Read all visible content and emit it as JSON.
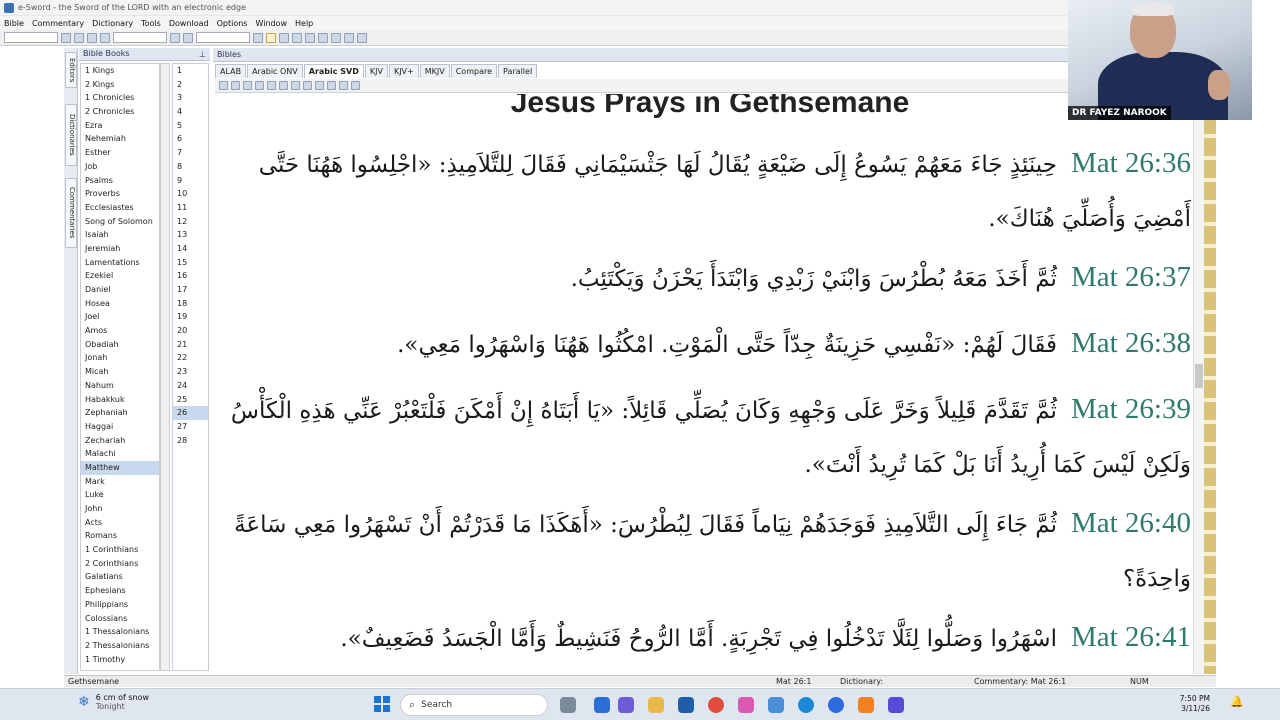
{
  "window": {
    "title": "e-Sword - the Sword of the LORD with an electronic edge"
  },
  "menu": [
    "Bible",
    "Commentary",
    "Dictionary",
    "Tools",
    "Download",
    "Options",
    "Window",
    "Help"
  ],
  "left_tabs": [
    "Editors",
    "Dictionaries",
    "Commentaries"
  ],
  "bible_books_header": "Bible Books",
  "books": [
    "1 Kings",
    "2 Kings",
    "1 Chronicles",
    "2 Chronicles",
    "Ezra",
    "Nehemiah",
    "Esther",
    "Job",
    "Psalms",
    "Proverbs",
    "Ecclesiastes",
    "Song of Solomon",
    "Isaiah",
    "Jeremiah",
    "Lamentations",
    "Ezekiel",
    "Daniel",
    "Hosea",
    "Joel",
    "Amos",
    "Obadiah",
    "Jonah",
    "Micah",
    "Nahum",
    "Habakkuk",
    "Zephaniah",
    "Haggai",
    "Zechariah",
    "Malachi",
    "Matthew",
    "Mark",
    "Luke",
    "John",
    "Acts",
    "Romans",
    "1 Corinthians",
    "2 Corinthians",
    "Galatians",
    "Ephesians",
    "Philippians",
    "Colossians",
    "1 Thessalonians",
    "2 Thessalonians",
    "1 Timothy"
  ],
  "selected_book": "Matthew",
  "chapters": [
    "1",
    "2",
    "3",
    "4",
    "5",
    "6",
    "7",
    "8",
    "9",
    "10",
    "11",
    "12",
    "13",
    "14",
    "15",
    "16",
    "17",
    "18",
    "19",
    "20",
    "21",
    "22",
    "23",
    "24",
    "25",
    "26",
    "27",
    "28"
  ],
  "selected_chapter": "26",
  "bibles_header": "Bibles",
  "bible_tabs": [
    "ALAB",
    "Arabic ONV",
    "Arabic SVD",
    "KJV",
    "KJV+",
    "MKJV",
    "Compare",
    "Parallel"
  ],
  "active_bible_tab": "Arabic SVD",
  "reader": {
    "heading": "Jesus Prays in Gethsemane",
    "verses": [
      {
        "ref": "Mat 26:36",
        "text": "حِينَئِذٍ جَاءَ مَعَهُمْ يَسُوعُ إِلَى ضَيْعَةٍ يُقَالُ لَهَا جَثْسَيْمَانِي فَقَالَ لِلتَّلاَمِيذِ: «اجْلِسُوا هَهُنَا حَتَّى أَمْضِيَ وَأُصَلِّيَ هُنَاكَ»."
      },
      {
        "ref": "Mat 26:37",
        "text": "ثُمَّ أَخَذَ مَعَهُ بُطْرُسَ وَابْنَيْ زَبْدِي وَابْتَدَأَ يَحْزَنُ وَيَكْتَئِبُ."
      },
      {
        "ref": "Mat 26:38",
        "text": "فَقَالَ لَهُمْ: «نَفْسِي حَزِينَةٌ جِدّاً حَتَّى الْمَوْتِ. امْكُثُوا هَهُنَا وَاسْهَرُوا مَعِي»."
      },
      {
        "ref": "Mat 26:39",
        "text": "ثُمَّ تَقَدَّمَ قَلِيلاً وَخَرَّ عَلَى وَجْهِهِ وَكَانَ يُصَلِّي قَائِلاً: «يَا أَبَتَاهُ إِنْ أَمْكَنَ فَلْتَعْبُرْ عَنِّي هَذِهِ الْكَأْسُ وَلَكِنْ لَيْسَ كَمَا أُرِيدُ أَنَا بَلْ كَمَا تُرِيدُ أَنْتَ»."
      },
      {
        "ref": "Mat 26:40",
        "text": "ثُمَّ جَاءَ إِلَى التَّلاَمِيذِ فَوَجَدَهُمْ نِيَاماً فَقَالَ لِبُطْرُسَ: «أَهَكَذَا مَا قَدَرْتُمْ أَنْ تَسْهَرُوا مَعِي سَاعَةً وَاحِدَةً؟"
      },
      {
        "ref": "Mat 26:41",
        "text": "اسْهَرُوا وَصَلُّوا لِئَلَّا تَدْخُلُوا فِي تَجْرِبَةٍ. أَمَّا الرُّوحُ فَنَشِيطٌ وَأَمَّا الْجَسَدُ فَضَعِيفٌ»."
      }
    ]
  },
  "status": {
    "left": "Gethsemane",
    "verse": "Mat 26:1",
    "dictionary": "Dictionary:",
    "commentary": "Commentary: Mat 26:1",
    "num": "NUM"
  },
  "webcam": {
    "name": "DR FAYEZ NAROOK"
  },
  "taskbar": {
    "weather_line1": "6 cm of snow",
    "weather_line2": "Tonight",
    "search_label": "Search",
    "time": "7:50 PM",
    "date": "3/11/26"
  },
  "colors": {
    "verse_ref": "#2e7a6e",
    "accent": "#1a73d8"
  }
}
